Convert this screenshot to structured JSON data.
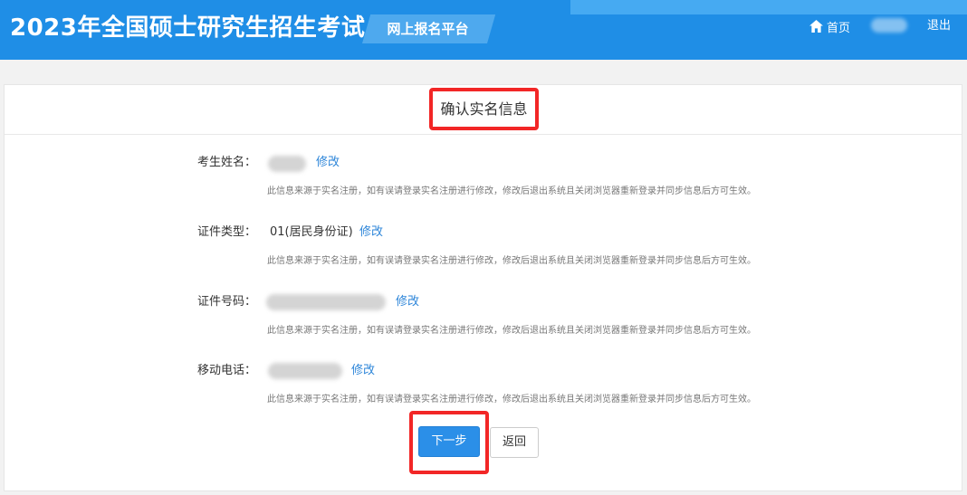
{
  "header": {
    "site_title": "2023年全国硕士研究生招生考试",
    "platform_label": "网上报名平台",
    "nav": {
      "home_label": "首页",
      "logout_label": "退出"
    },
    "colors": {
      "bar": "#1f8ee6",
      "strip": "#46aaf2",
      "tag": "#4ea9ee"
    }
  },
  "card": {
    "title": "确认实名信息",
    "fields": [
      {
        "label": "考生姓名：",
        "value": "",
        "value_redacted": true,
        "edit_label": "修改",
        "hint": "此信息来源于实名注册，如有误请登录实名注册进行修改，修改后退出系统且关闭浏览器重新登录并同步信息后方可生效。"
      },
      {
        "label": "证件类型：",
        "value": "01(居民身份证)",
        "value_redacted": false,
        "edit_label": "修改",
        "hint": "此信息来源于实名注册，如有误请登录实名注册进行修改，修改后退出系统且关闭浏览器重新登录并同步信息后方可生效。"
      },
      {
        "label": "证件号码：",
        "value": "",
        "value_redacted": true,
        "edit_label": "修改",
        "hint": "此信息来源于实名注册，如有误请登录实名注册进行修改，修改后退出系统且关闭浏览器重新登录并同步信息后方可生效。"
      },
      {
        "label": "移动电话：",
        "value": "",
        "value_redacted": true,
        "edit_label": "修改",
        "hint": "此信息来源于实名注册，如有误请登录实名注册进行修改，修改后退出系统且关闭浏览器重新登录并同步信息后方可生效。"
      }
    ]
  },
  "actions": {
    "next_label": "下一步",
    "back_label": "返回"
  },
  "icons": {
    "home": "home-icon"
  },
  "colors": {
    "primary": "#2b8fe8",
    "link": "#2e86d9",
    "highlight": "#f22626"
  }
}
